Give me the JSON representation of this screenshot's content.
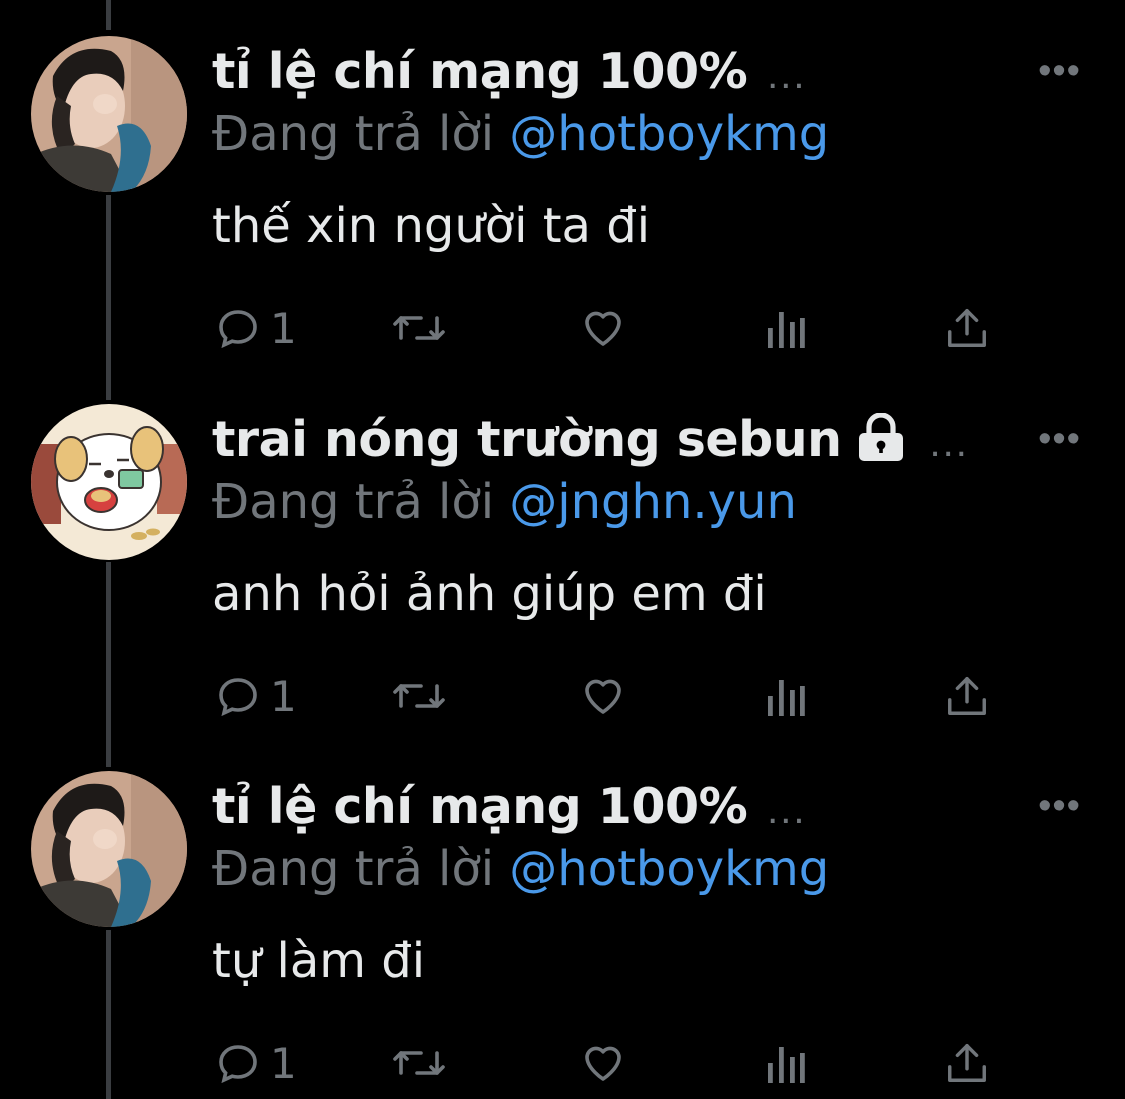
{
  "tweets": [
    {
      "name": "tỉ lệ chí mạng 100%",
      "locked": false,
      "ellipsis": "...",
      "more": "•••",
      "replying_prefix": "Đang trả lời",
      "replying_handle": "@hotboykmg",
      "text": "thế xin người ta đi",
      "reply_count": "1",
      "avatar": "photo-avatar"
    },
    {
      "name": "trai nóng trường sebun",
      "locked": true,
      "ellipsis": "...",
      "more": "•••",
      "replying_prefix": "Đang trả lời",
      "replying_handle": "@jnghn.yun",
      "text": "anh hỏi ảnh giúp em đi",
      "reply_count": "1",
      "avatar": "cartoon-dog-avatar"
    },
    {
      "name": "tỉ lệ chí mạng 100%",
      "locked": false,
      "ellipsis": "...",
      "more": "•••",
      "replying_prefix": "Đang trả lời",
      "replying_handle": "@hotboykmg",
      "text": "tự làm đi",
      "reply_count": "1",
      "avatar": "photo-avatar"
    }
  ],
  "icons": [
    "reply-icon",
    "retweet-icon",
    "like-icon",
    "views-icon",
    "share-icon",
    "lock-icon",
    "more-icon"
  ],
  "colors": {
    "background": "#000000",
    "text": "#e7e9ea",
    "muted": "#71767b",
    "link": "#4a99e9",
    "thread_line": "#3a3d41"
  }
}
